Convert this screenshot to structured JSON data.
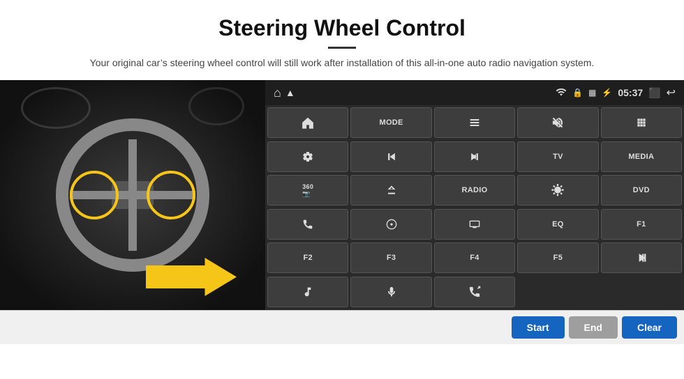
{
  "header": {
    "title": "Steering Wheel Control",
    "subtitle": "Your original car’s steering wheel control will still work after installation of this all-in-one auto radio navigation system."
  },
  "topbar": {
    "home_icon": "⌂",
    "wifi_icon": "WiFi",
    "lock_icon": "🔒",
    "sim_icon": "SIM",
    "bt_icon": "BT",
    "time": "05:37",
    "screen_icon": "⬜",
    "back_icon": "↩"
  },
  "buttons": [
    {
      "label": "⬆",
      "icon": true,
      "row": 1
    },
    {
      "label": "MODE"
    },
    {
      "label": "≡",
      "icon": true
    },
    {
      "label": "🔇",
      "icon": true
    },
    {
      "label": "⠿",
      "icon": true
    },
    {
      "label": "⚙",
      "icon": true,
      "row": 2
    },
    {
      "label": "⏮",
      "icon": true
    },
    {
      "label": "⏭",
      "icon": true
    },
    {
      "label": "TV"
    },
    {
      "label": "MEDIA"
    },
    {
      "label": "360",
      "row": 3
    },
    {
      "label": "⏏",
      "icon": true
    },
    {
      "label": "RADIO"
    },
    {
      "label": "☀",
      "icon": true
    },
    {
      "label": "DVD"
    },
    {
      "label": "📞",
      "icon": true,
      "row": 4
    },
    {
      "label": "⊙",
      "icon": true
    },
    {
      "label": "━",
      "icon": true
    },
    {
      "label": "EQ"
    },
    {
      "label": "F1"
    },
    {
      "label": "F2",
      "row": 5
    },
    {
      "label": "F3"
    },
    {
      "label": "F4"
    },
    {
      "label": "F5"
    },
    {
      "label": "▶⏸",
      "icon": true
    },
    {
      "label": "♫",
      "icon": true,
      "row": 6
    },
    {
      "label": "🎤",
      "icon": true
    },
    {
      "label": "📞↗",
      "icon": true
    },
    {
      "label": "",
      "colspan": 2
    }
  ],
  "bottom_buttons": {
    "start": "Start",
    "end": "End",
    "clear": "Clear"
  }
}
